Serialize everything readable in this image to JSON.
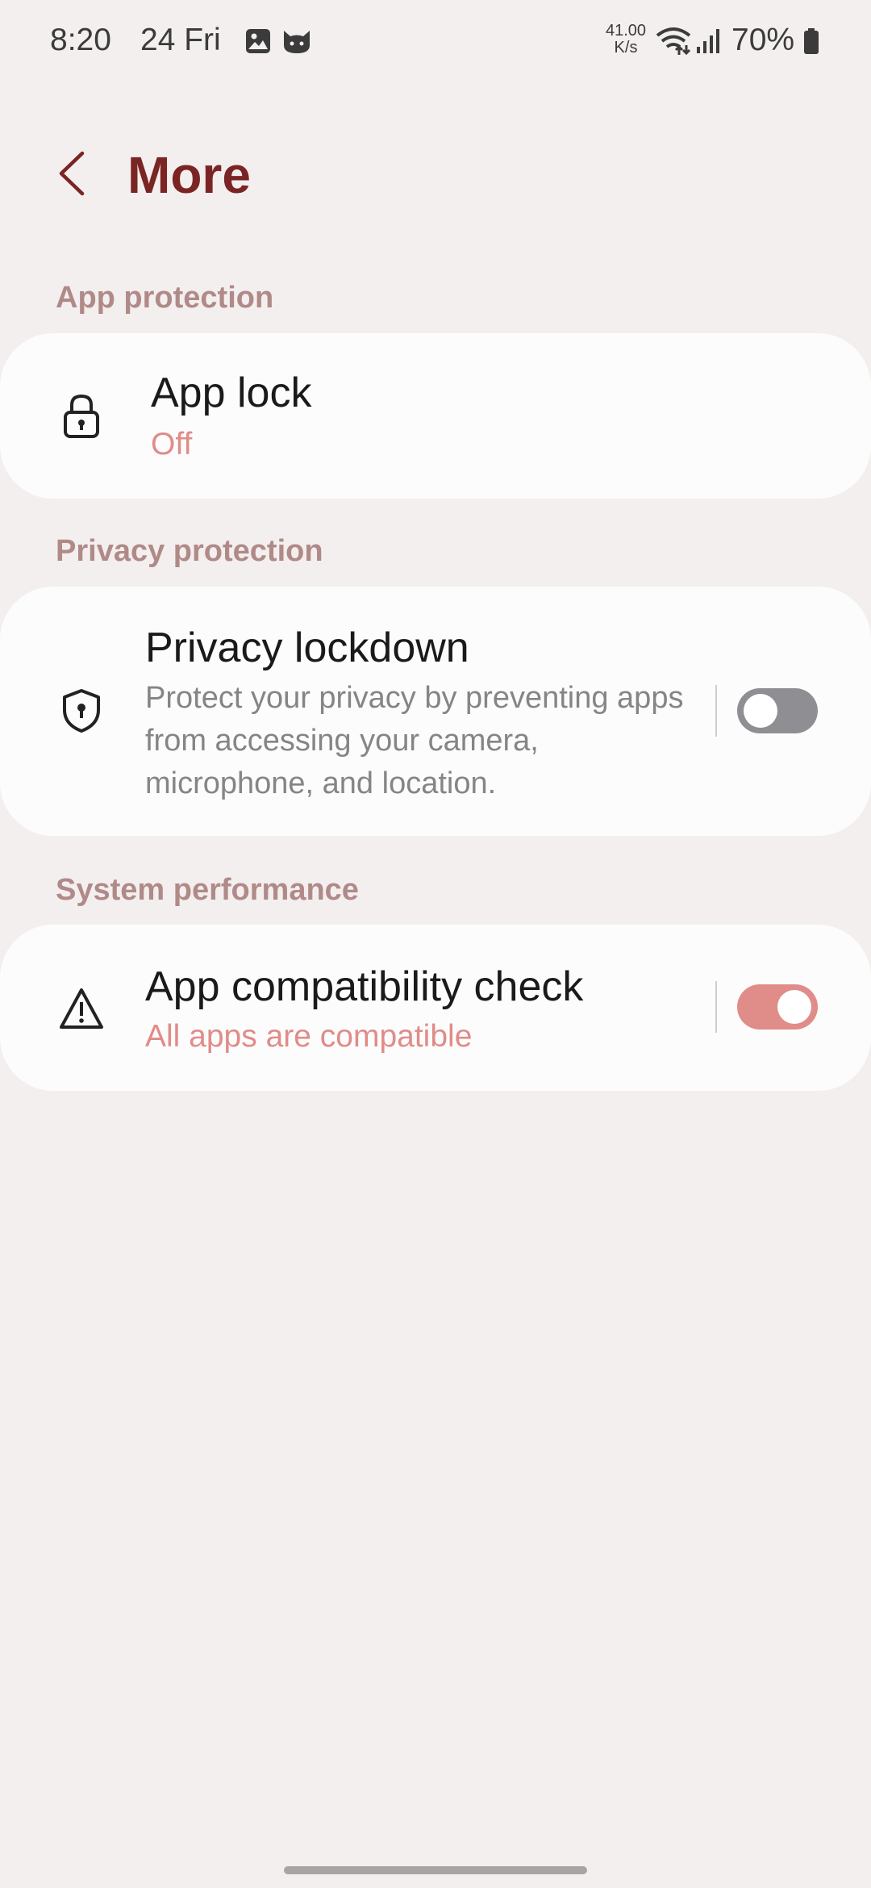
{
  "status_bar": {
    "time": "8:20",
    "date": "24 Fri",
    "speed_value": "41.00",
    "speed_unit": "K/s",
    "battery": "70%"
  },
  "header": {
    "back_icon": "chevron-left-icon",
    "title": "More"
  },
  "sections": [
    {
      "header": "App protection",
      "item": {
        "icon": "lock-icon",
        "title": "App lock",
        "subtitle": "Off"
      }
    },
    {
      "header": "Privacy protection",
      "item": {
        "icon": "shield-alert-icon",
        "title": "Privacy lockdown",
        "description": "Protect your privacy by preventing apps from accessing your camera, microphone, and location.",
        "toggle": false
      }
    },
    {
      "header": "System performance",
      "item": {
        "icon": "warning-triangle-icon",
        "title": "App compatibility check",
        "subtitle": "All apps are compatible",
        "toggle": true
      }
    }
  ],
  "colors": {
    "background": "#f3efee",
    "card": "#fdfcfc",
    "title": "#7b2424",
    "section_header": "#b08a88",
    "accent": "#e08c89",
    "toggle_off": "#8f8f93"
  }
}
